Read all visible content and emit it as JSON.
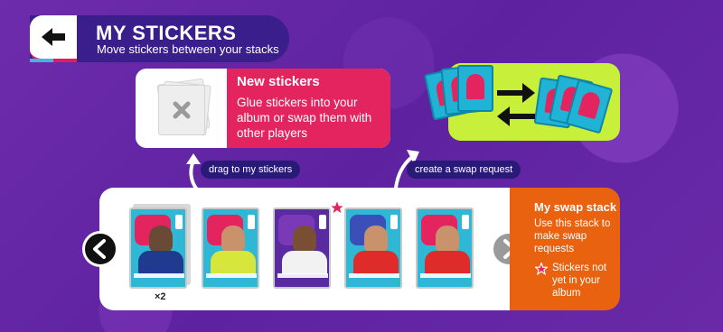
{
  "header": {
    "title": "MY STICKERS",
    "subtitle": "Move stickers between your stacks"
  },
  "new_stickers": {
    "title": "New stickers",
    "description": "Glue stickers into your album or swap them with other players"
  },
  "pills": {
    "drag": "drag to my stickers",
    "swap": "create a swap request"
  },
  "swap_stack": {
    "title": "My swap stack",
    "description": "Use this stack to make swap requests",
    "note": "Stickers not yet in your album"
  },
  "stack": {
    "first_count": "×2",
    "stickers": [
      {
        "id": "sticker-1",
        "bg": "#2fb8d6",
        "shirt": "#1f3a8f",
        "big": "#e3245f"
      },
      {
        "id": "sticker-2",
        "bg": "#2fb8d6",
        "shirt": "#d6e63a",
        "big": "#e3245f"
      },
      {
        "id": "sticker-3",
        "bg": "#5a2aa0",
        "shirt": "#f2f2f2",
        "big": "#e3245f"
      },
      {
        "id": "sticker-4",
        "bg": "#2fb8d6",
        "shirt": "#e02b2b",
        "big": "#e3245f"
      },
      {
        "id": "sticker-5",
        "bg": "#2fb8d6",
        "shirt": "#e02b2b",
        "big": "#e3245f"
      }
    ]
  },
  "colors": {
    "background": "#6a2aa8",
    "header": "#3a1f8c",
    "pink": "#e3245f",
    "orange": "#e8620f",
    "lime": "#c8f03a",
    "cyan": "#21b3d6"
  },
  "icons": {
    "back": "arrow-left-icon",
    "close": "close-icon",
    "prev": "chevron-left-icon",
    "next": "chevron-right-icon",
    "star": "star-icon",
    "swap": "swap-arrows-icon"
  }
}
